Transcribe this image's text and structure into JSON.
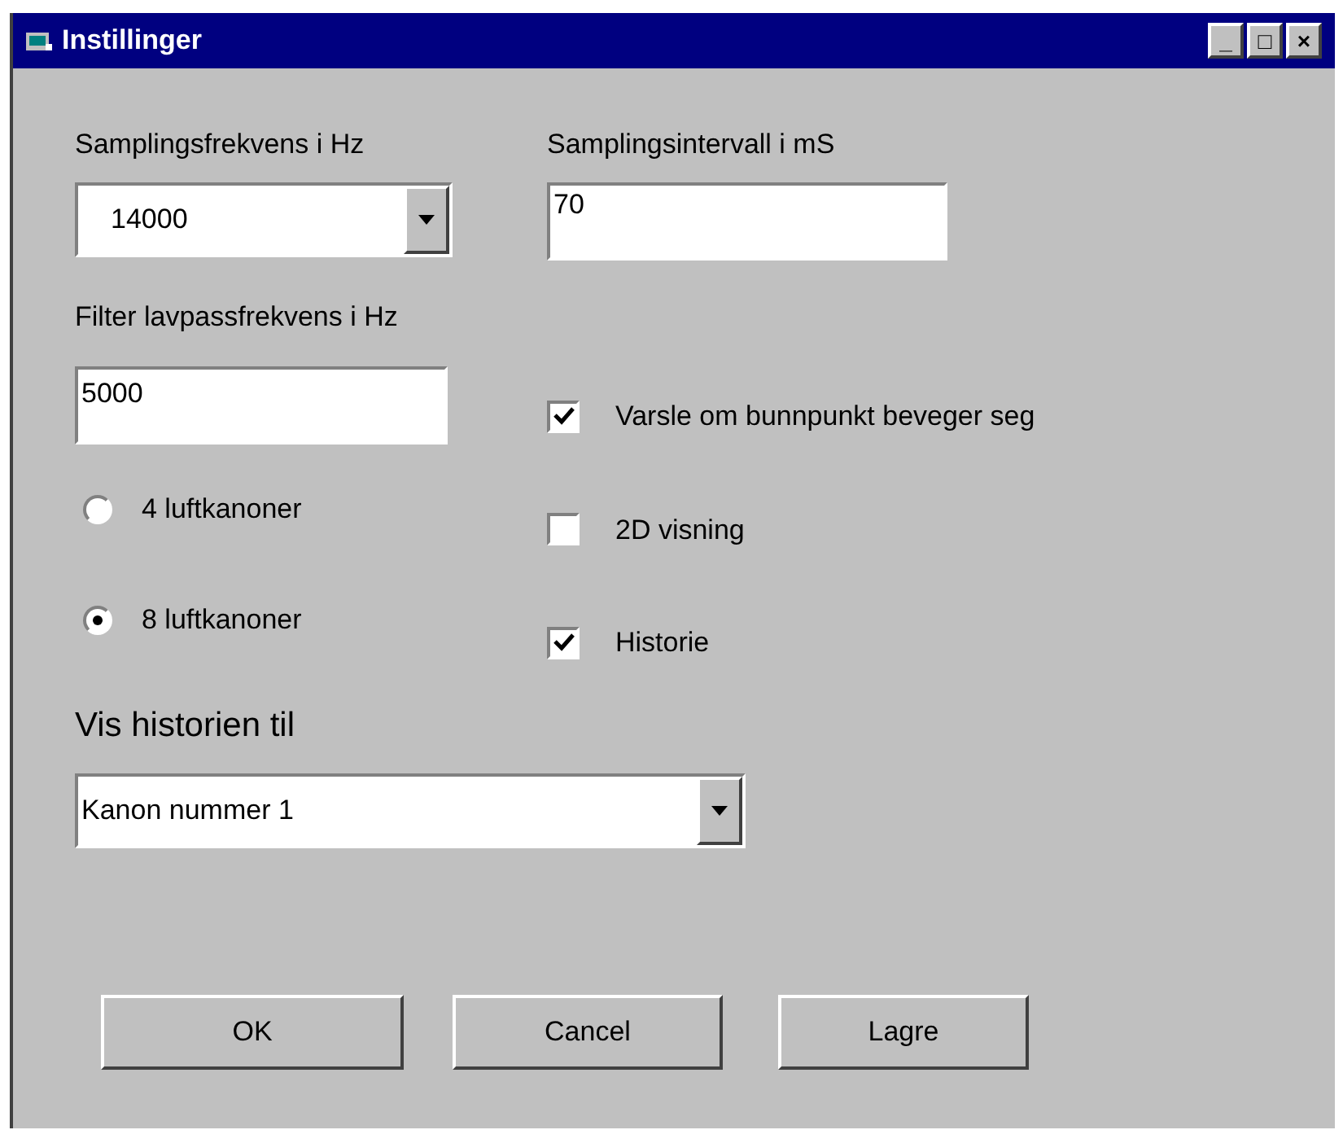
{
  "window": {
    "title": "Instillinger",
    "controls": [
      "_",
      "□",
      "×"
    ]
  },
  "sampling_frequency": {
    "label": "Samplingsfrekvens i Hz",
    "value": "14000"
  },
  "sampling_interval": {
    "label": "Samplingsintervall i mS",
    "value": "70"
  },
  "filter": {
    "label": "Filter lavpassfrekvens i Hz",
    "value": "5000"
  },
  "radios": [
    {
      "label": "4 luftkanoner",
      "selected": false
    },
    {
      "label": "8 luftkanoner",
      "selected": true
    }
  ],
  "checkboxes": [
    {
      "label": "Varsle om bunnpunkt beveger seg",
      "checked": true
    },
    {
      "label": "2D visning",
      "checked": false
    },
    {
      "label": "Historie",
      "checked": true
    }
  ],
  "history": {
    "label": "Vis historien til",
    "value": "Kanon nummer 1"
  },
  "buttons": [
    "OK",
    "Cancel",
    "Lagre"
  ]
}
